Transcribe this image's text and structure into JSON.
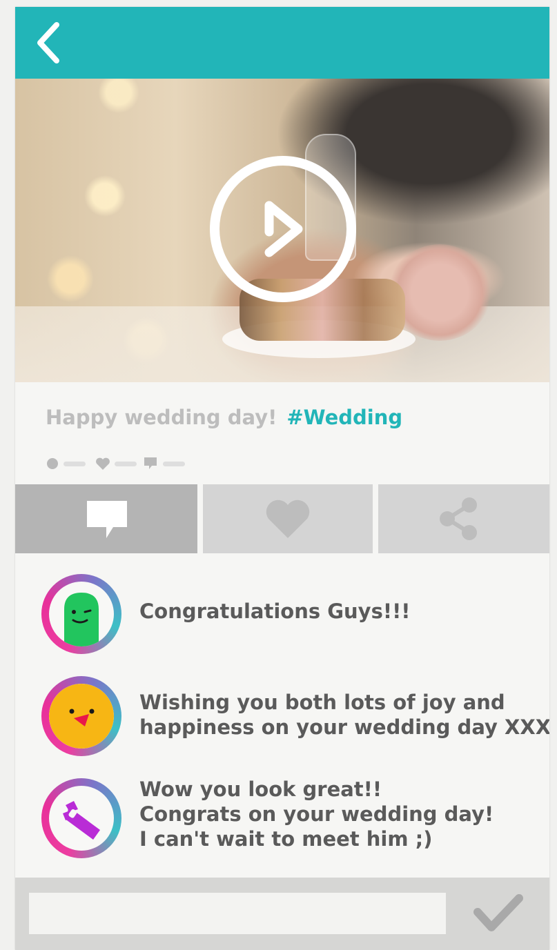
{
  "post": {
    "caption": "Happy wedding day!",
    "hashtag": "#Wedding"
  },
  "icons": {
    "back": "chevron-left-icon",
    "play": "play-icon",
    "comment": "comment-bubble-icon",
    "like": "heart-icon",
    "share": "share-icon",
    "send": "checkmark-icon"
  },
  "colors": {
    "accent": "#22b5b8",
    "caption_text": "#bdbdbd",
    "comment_text": "#5a5a5a",
    "action_active": "#b4b4b4",
    "action_inactive": "#d4d4d4",
    "avatar_ring_pink": "#ec3da0",
    "avatar_ring_teal": "#3cc0c6"
  },
  "comments": [
    {
      "avatar": "green-blob-winking-avatar",
      "lines": [
        "Congratulations Guys!!!"
      ]
    },
    {
      "avatar": "yellow-chick-avatar",
      "lines": [
        "Wishing you both lots of joy and",
        "happiness on your wedding day XXX"
      ]
    },
    {
      "avatar": "purple-bunny-avatar",
      "lines": [
        "Wow you look great!!",
        "Congrats on your wedding day!",
        "I can't wait to meet him ;)"
      ]
    }
  ],
  "composer": {
    "value": "",
    "placeholder": ""
  }
}
